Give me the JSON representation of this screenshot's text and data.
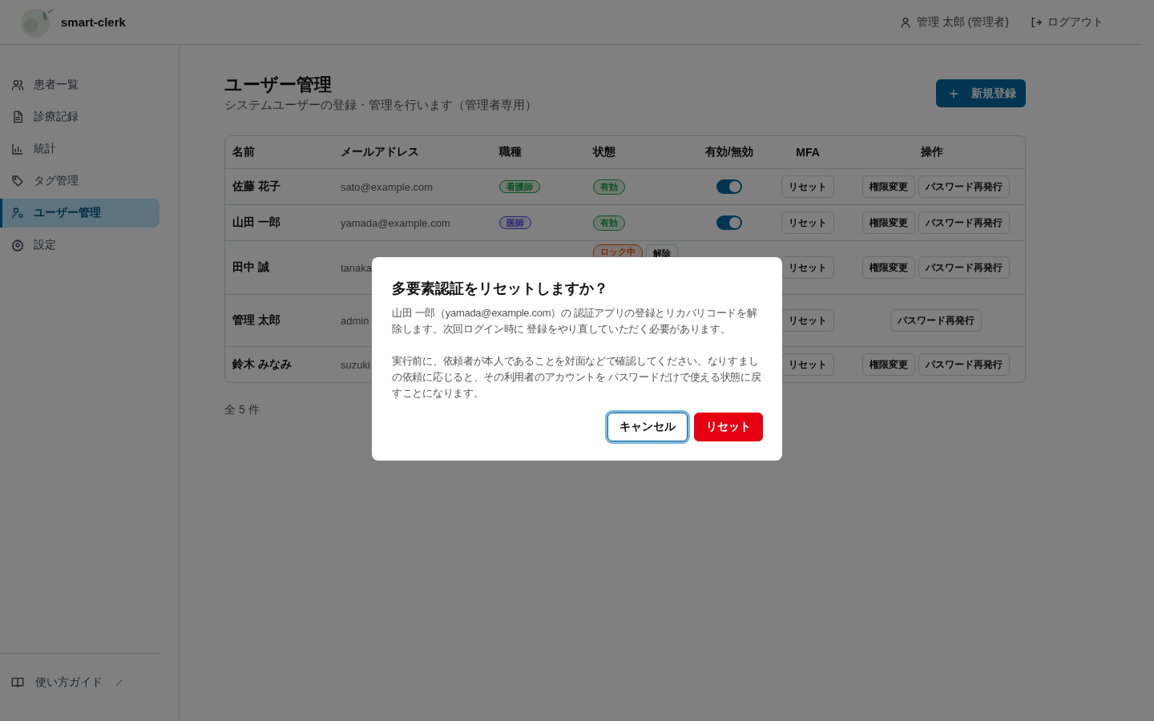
{
  "header": {
    "app_name": "smart-clerk",
    "user": "管理 太郎 (管理者)",
    "logout": "ログアウト"
  },
  "sidebar": {
    "items": [
      {
        "label": "患者一覧",
        "selected": false
      },
      {
        "label": "診療記録",
        "selected": false
      },
      {
        "label": "統計",
        "selected": false
      },
      {
        "label": "タグ管理",
        "selected": false
      },
      {
        "label": "ユーザー管理",
        "selected": true
      },
      {
        "label": "設定",
        "selected": false
      }
    ],
    "footer": {
      "label": "使い方ガイド"
    }
  },
  "page": {
    "title": "ユーザー管理",
    "subtitle": "システムユーザーの登録・管理を行います（管理者専用）",
    "new_button": "新規登録"
  },
  "table": {
    "columns": [
      "名前",
      "メールアドレス",
      "職種",
      "状態",
      "有効/無効",
      "MFA",
      "操作"
    ],
    "rows": [
      {
        "name": "佐藤 花子",
        "email": "sato@example.com",
        "role": {
          "label": "看護師",
          "color": "#0b5125"
        },
        "status": [
          {
            "kind": "badge",
            "label": "有効",
            "color": "#0b5125"
          }
        ],
        "enabled": true,
        "mfa": "リセット",
        "actions": [
          "権限変更",
          "パスワード再発行"
        ]
      },
      {
        "name": "山田 一郎",
        "email": "yamada@example.com",
        "role": {
          "label": "医師",
          "color": "#282373"
        },
        "status": [
          {
            "kind": "badge",
            "label": "有効",
            "color": "#0b5125"
          }
        ],
        "enabled": true,
        "mfa": "リセット",
        "actions": [
          "権限変更",
          "パスワード再発行"
        ]
      },
      {
        "name": "田中 誠",
        "email": "tanaka",
        "status": [
          {
            "kind": "badge",
            "label": "ロック中",
            "color": "#752c06"
          },
          {
            "kind": "button",
            "label": "解除"
          }
        ],
        "mfa": "リセット",
        "actions": [
          "権限変更",
          "パスワード再発行"
        ]
      },
      {
        "name": "管理 太郎",
        "email": "admin",
        "mfa": "リセット",
        "actions": [
          "パスワード再発行"
        ]
      },
      {
        "name": "鈴木 みなみ",
        "email": "suzuki",
        "mfa": "リセット",
        "actions": [
          "権限変更",
          "パスワード再発行"
        ]
      }
    ]
  },
  "count": "全 5 件",
  "dialog": {
    "title": "多要素認証をリセットしますか？",
    "paragraphs": [
      "山田 一郎（yamada@example.com）の 認証アプリの登録とリカバリコードを解除します。次回ログイン時に 登録をやり直していただく必要があります。",
      "実行前に、依頼者が本人であることを対面などで確認してください。なりすましの依頼に応じると、その利用者のアカウントを パスワードだけで使える状態に戻すことになります。"
    ],
    "buttons": [
      {
        "kind": "secondary",
        "label": "キャンセル",
        "focused": true
      },
      {
        "kind": "danger",
        "label": "リセット",
        "focused": false
      }
    ]
  }
}
